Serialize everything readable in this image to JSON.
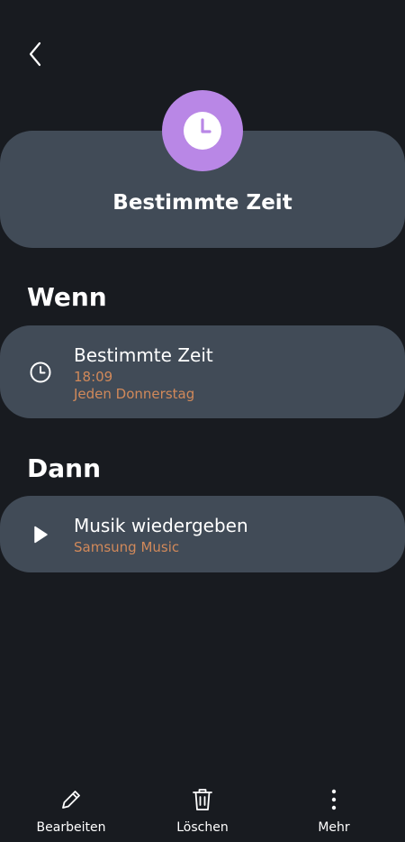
{
  "header": {
    "title": "Bestimmte Zeit",
    "icon": "clock-icon",
    "icon_color": "#b987e6"
  },
  "when": {
    "heading": "Wenn",
    "condition": {
      "icon": "clock-icon",
      "title": "Bestimmte Zeit",
      "time": "18:09",
      "repeat": "Jeden Donnerstag"
    }
  },
  "then": {
    "heading": "Dann",
    "action": {
      "icon": "play-icon",
      "title": "Musik wiedergeben",
      "app": "Samsung Music"
    }
  },
  "bottom_nav": {
    "edit_label": "Bearbeiten",
    "delete_label": "Löschen",
    "more_label": "Mehr"
  },
  "colors": {
    "background": "#181b20",
    "card": "#414b57",
    "accent_text": "#d1895a"
  }
}
